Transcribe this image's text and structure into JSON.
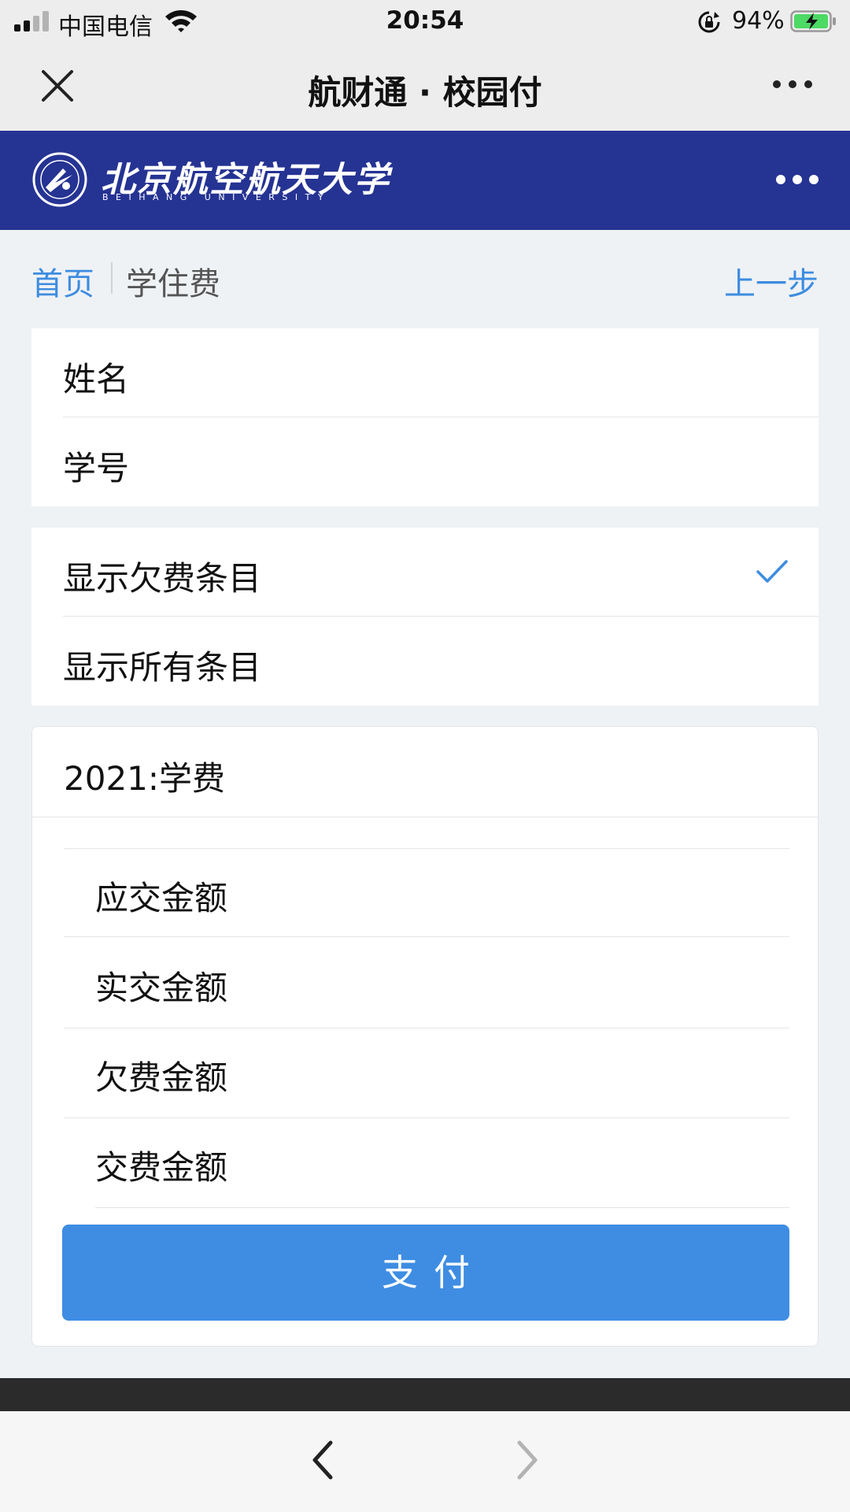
{
  "status_bar": {
    "carrier": "中国电信",
    "time": "20:54",
    "battery_percent": "94%"
  },
  "nav": {
    "title": "航财通 · 校园付"
  },
  "banner": {
    "university_name": "北京航空航天大学",
    "university_name_en": "BEIHANG UNIVERSITY"
  },
  "breadcrumb": {
    "home": "首页",
    "current": "学住费",
    "back": "上一步"
  },
  "student_info": {
    "name_label": "姓名",
    "id_label": "学号"
  },
  "filter": {
    "options": [
      {
        "label": "显示欠费条目",
        "selected": true
      },
      {
        "label": "显示所有条目",
        "selected": false
      }
    ]
  },
  "fee": {
    "title": "2021:学费",
    "rows": [
      {
        "label": "应交金额"
      },
      {
        "label": "实交金额"
      },
      {
        "label": "欠费金额"
      },
      {
        "label": "交费金额"
      }
    ],
    "pay_label": "支付"
  },
  "colors": {
    "banner": "#253393",
    "accent": "#3d8ce0",
    "pay_button": "#3e8de3"
  }
}
